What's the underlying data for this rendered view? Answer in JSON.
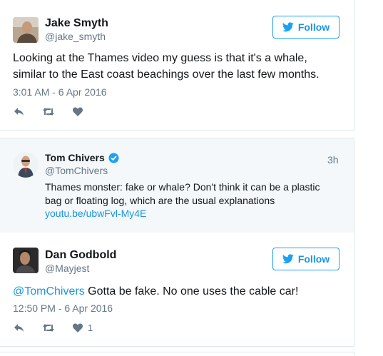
{
  "tweet1": {
    "name": "Jake Smyth",
    "handle": "@jake_smyth",
    "follow_label": "Follow",
    "text_line1": "Looking at the Thames video my guess is that it's a whale,",
    "text_line2": "similar to the East coast beachings over the last few months.",
    "timestamp": "3:01 AM - 6 Apr 2016",
    "actions": [
      {
        "icon": "reply-icon"
      },
      {
        "icon": "retweet-icon"
      },
      {
        "icon": "heart-icon"
      }
    ]
  },
  "quoted": {
    "name": "Tom Chivers",
    "verified": true,
    "handle": "@TomChivers",
    "time": "3h",
    "text_line1": "Thames monster: fake or whale? Don't think it can be a plastic",
    "text_line2": "bag or floating log, which are the usual explanations",
    "link": "youtu.be/ubwFvl-My4E"
  },
  "tweet2": {
    "name": "Dan Godbold",
    "handle": "@Mayjest",
    "follow_label": "Follow",
    "mention": "@TomChivers",
    "text_rest": " Gotta be fake. No one uses the cable car!",
    "timestamp": "12:50 PM - 6 Apr 2016",
    "like_count": "1"
  },
  "colors": {
    "accent": "#1da1f2",
    "link": "#1b95e0",
    "muted": "#657786",
    "border": "#e1e8ed",
    "quote_bg": "#f5f8fa"
  }
}
